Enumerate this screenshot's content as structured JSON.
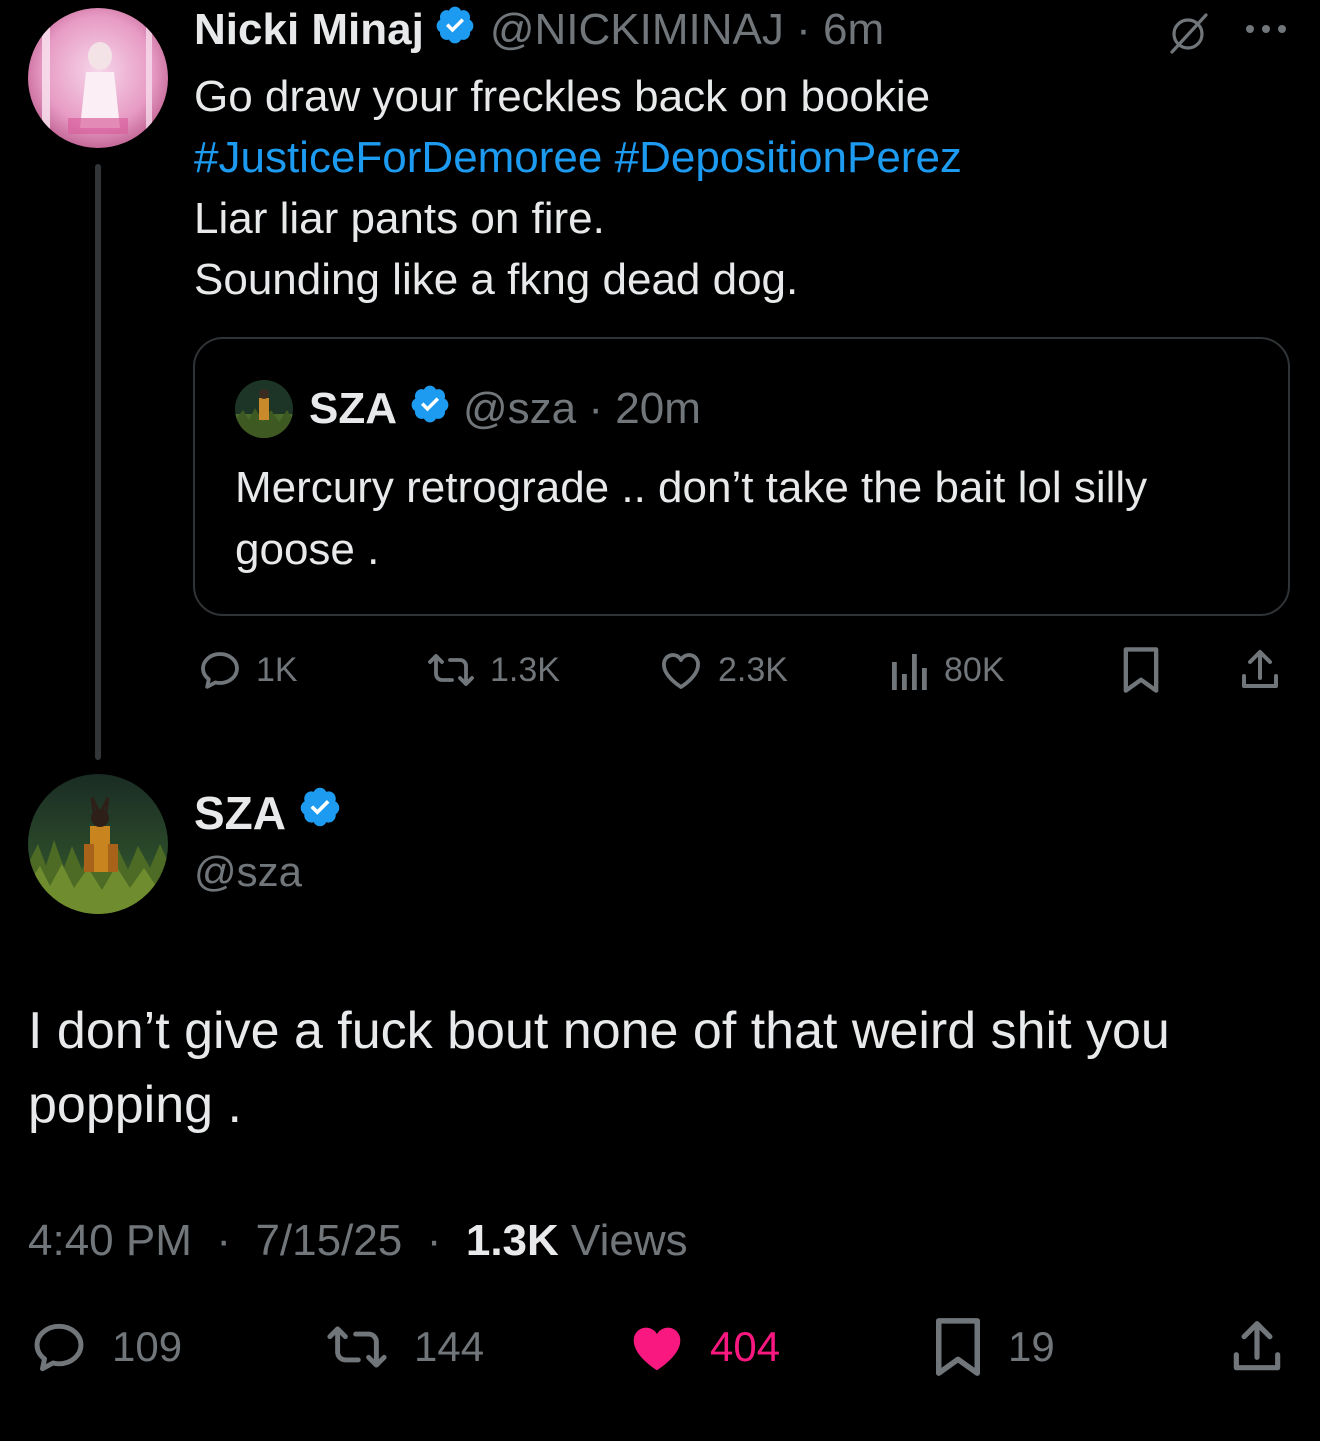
{
  "parent_tweet": {
    "author_name": "Nicki Minaj",
    "handle": "@NICKIMINAJ",
    "time": "6m",
    "text_line1": "Go draw your freckles back on bookie",
    "hashtag1": "#JusticeForDemoree",
    "hashtag2": "#DepositionPerez",
    "text_line3": "Liar liar pants on fire.",
    "text_line4": "Sounding like a fkng dead dog.",
    "quoted": {
      "author_name": "SZA",
      "handle": "@sza",
      "time": "20m",
      "text": "Mercury retrograde .. don’t take the bait lol silly goose ."
    },
    "stats": {
      "replies": "1K",
      "reposts": "1.3K",
      "likes": "2.3K",
      "views": "80K"
    },
    "icons": [
      "grok-icon",
      "more-icon",
      "reply-icon",
      "repost-icon",
      "like-icon",
      "views-icon",
      "bookmark-icon",
      "share-icon"
    ]
  },
  "main_tweet": {
    "author_name": "SZA",
    "handle": "@sza",
    "text": "I don’t give a fuck bout none of that weird shit you popping .",
    "time": "4:40 PM",
    "date": "7/15/25",
    "views_count": "1.3K",
    "views_label": "Views",
    "stats": {
      "replies": "109",
      "reposts": "144",
      "likes": "404",
      "bookmarks": "19"
    },
    "liked": true
  },
  "colors": {
    "background": "#000000",
    "text": "#e7e9ea",
    "muted": "#71767b",
    "link": "#1d9bf0",
    "like_active": "#f91880",
    "border": "#2f3336"
  }
}
